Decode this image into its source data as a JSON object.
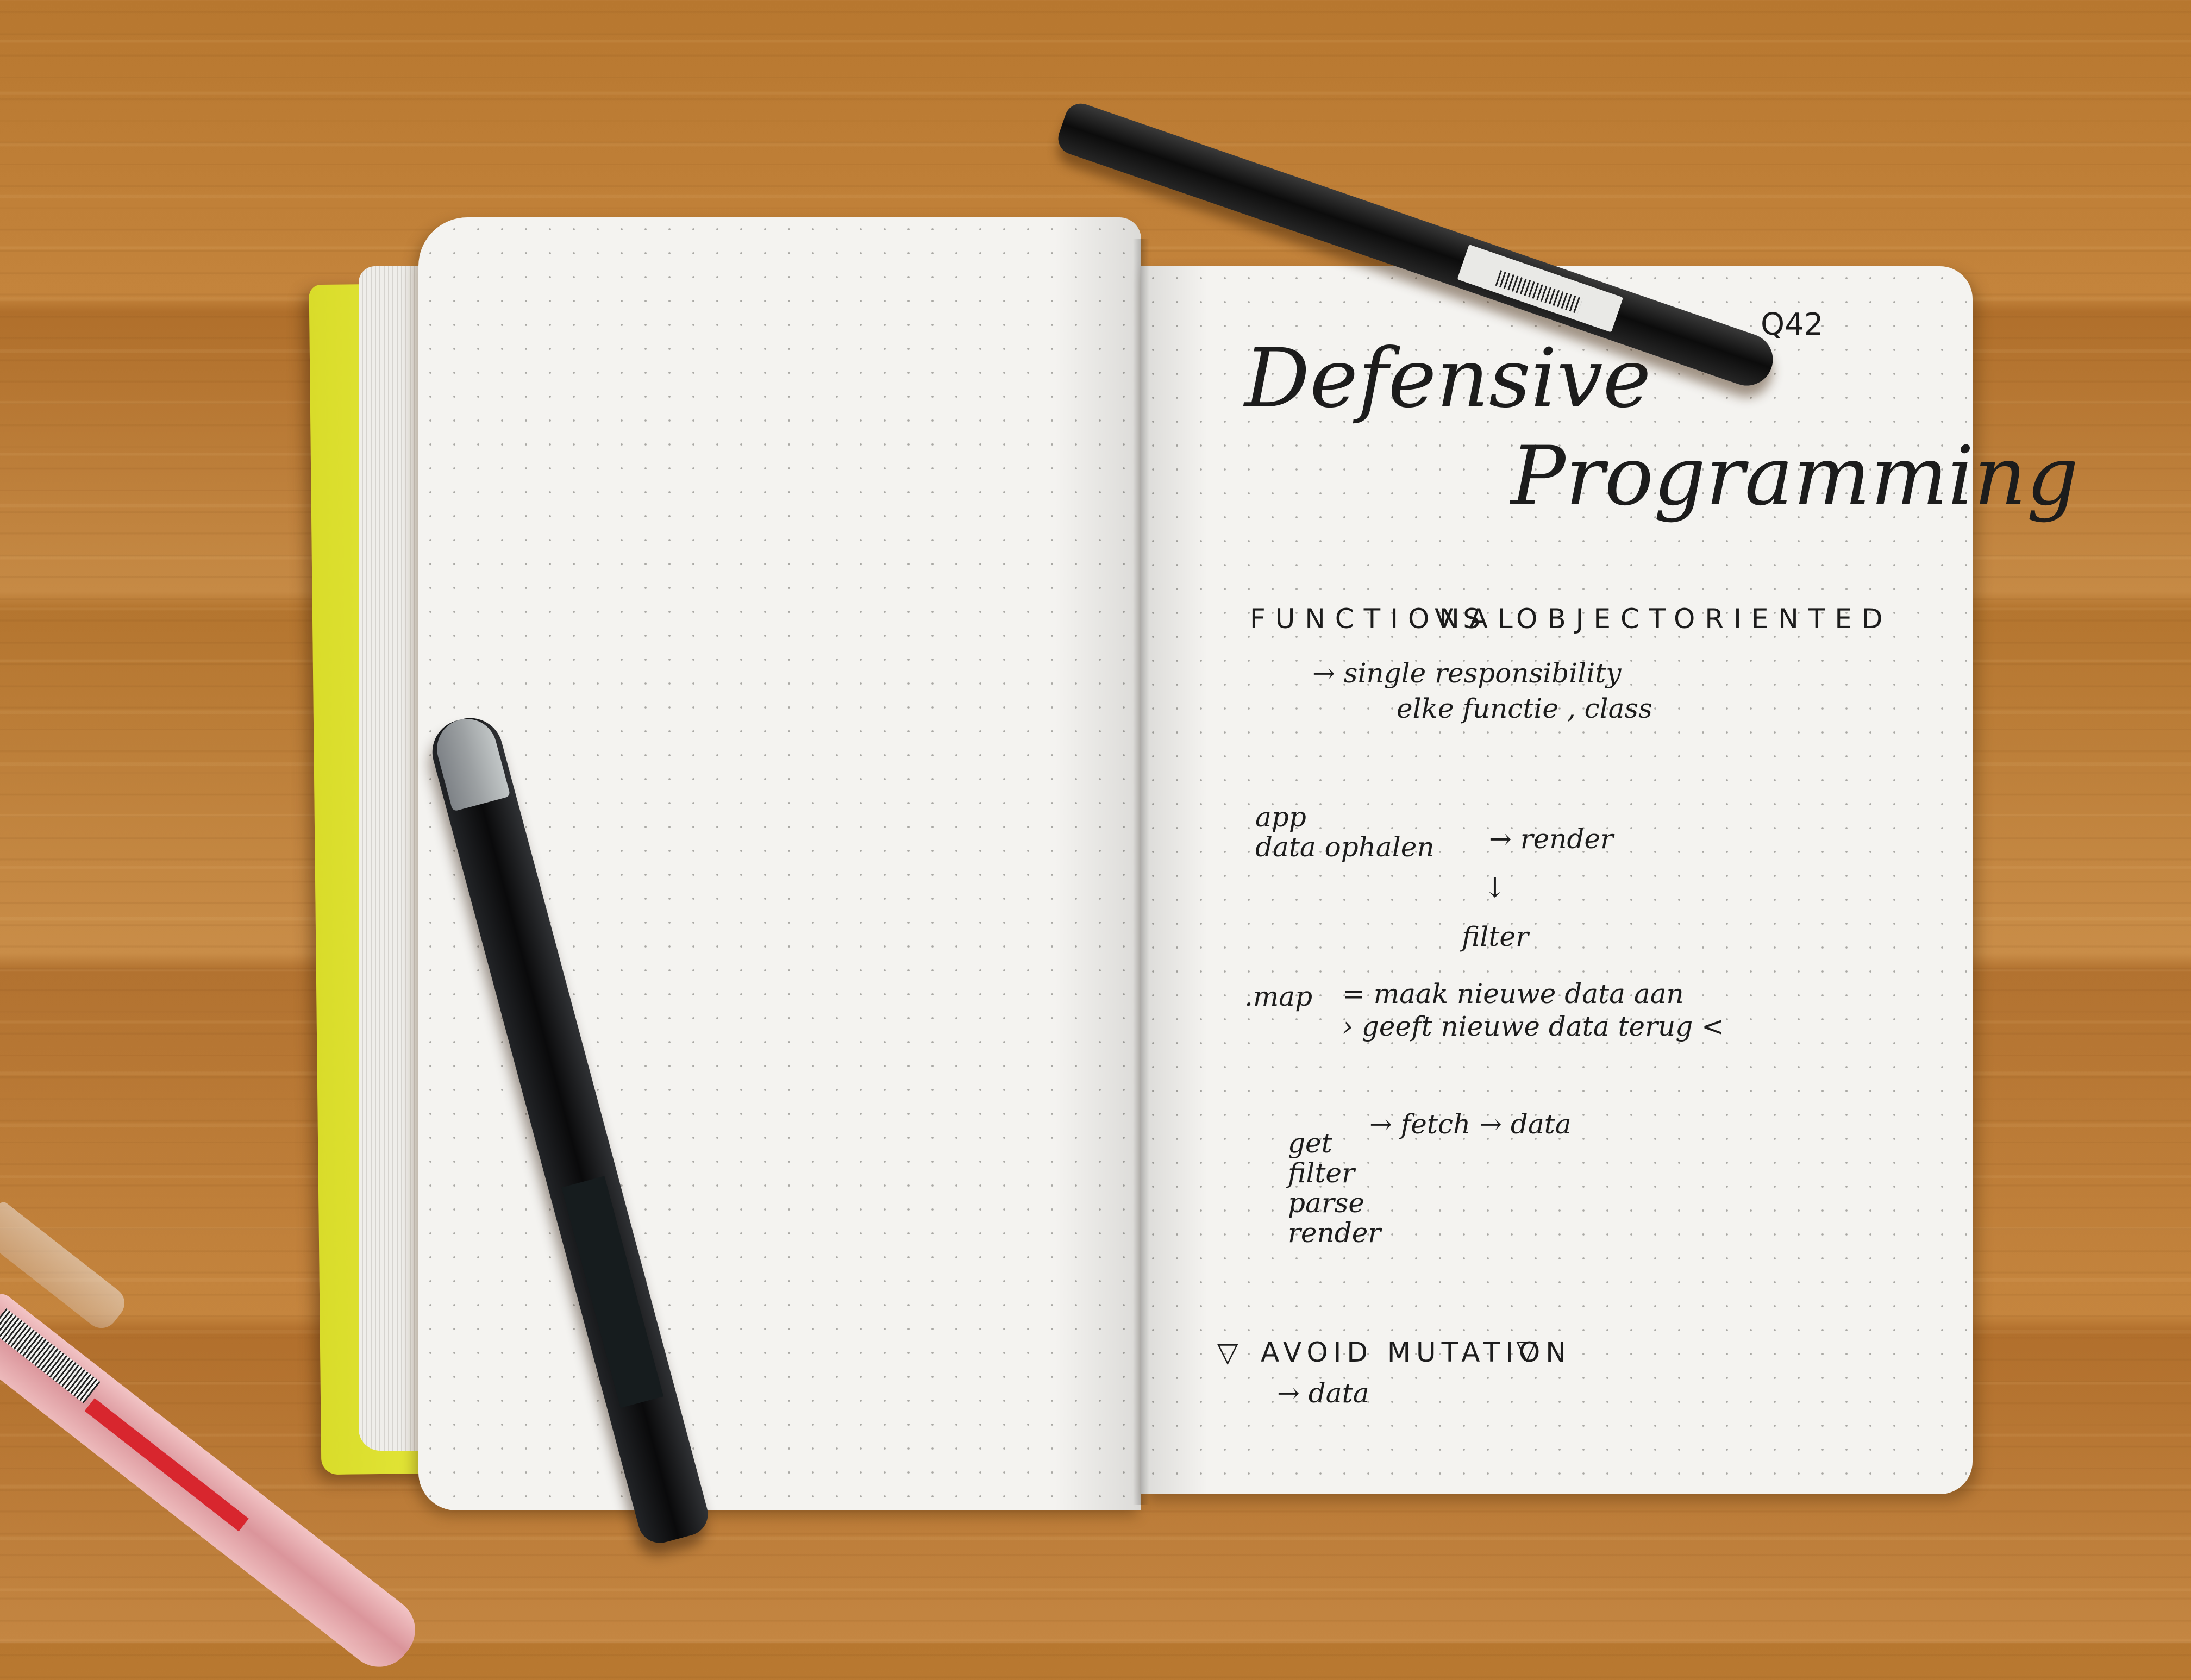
{
  "scene": {
    "description_colors": {
      "table": "#c08040",
      "paper": "#f4f3f0",
      "cover": "#ecee3e",
      "ink": "#1c1c1c"
    }
  },
  "notebook": {
    "page_number": "Q42",
    "title_line1": "Defensive",
    "title_line2": "Programming",
    "notes": [
      "FUNCTIONAL",
      "VS",
      "OBJECT",
      "ORIENTED",
      "→ single responsibility",
      "elke functie , class",
      "app",
      "data ophalen",
      "→ render",
      "↓",
      "filter",
      ".map",
      "= maak nieuwe data aan",
      "› geeft nieuwe data terug <",
      "get",
      "→ fetch → data",
      "filter",
      "parse",
      "render",
      "▽",
      "AVOID MUTATION",
      "▽",
      "→ data"
    ]
  }
}
